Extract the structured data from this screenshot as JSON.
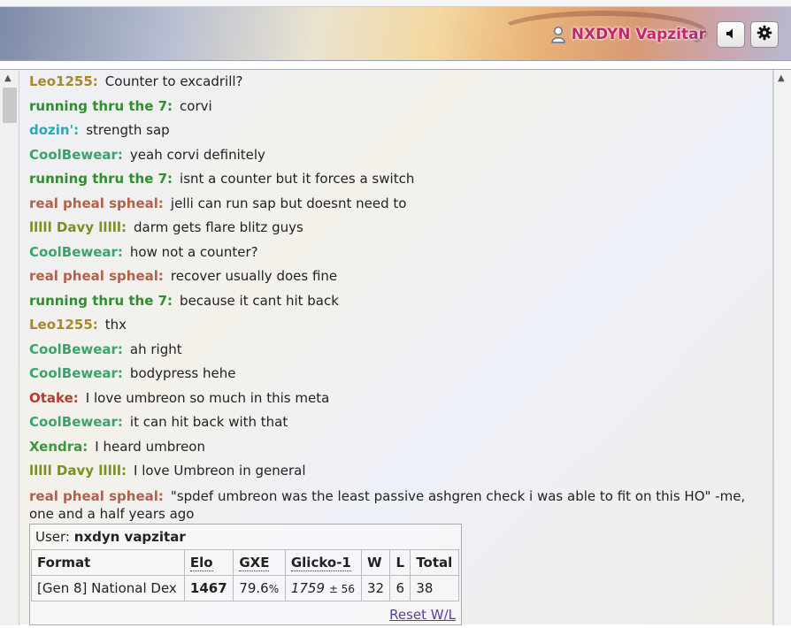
{
  "header": {
    "username": "NXDYN Vapzitar",
    "icons": {
      "user": "user-icon",
      "sound": "speaker-icon",
      "settings": "gear-icon"
    }
  },
  "colors": {
    "username_header": "#c0286a",
    "user_colors": {
      "Leo1255": "#a7882a",
      "running thru the 7": "#2f8f2f",
      "dozin'": "#2fa6b7",
      "CoolBewear": "#3aa36d",
      "real pheal spheal": "#b0624c",
      "Davy": "#7a8f1e",
      "Otake": "#b0402e",
      "Xendra": "#3a9a3a"
    }
  },
  "chat": {
    "messages": [
      {
        "user": "Leo1255:",
        "text": "Counter to excadrill?",
        "color": "#a7882a"
      },
      {
        "user": "running thru the 7:",
        "text": "corvi",
        "color": "#2f8f2f"
      },
      {
        "user": "dozin':",
        "text": "strength sap",
        "color": "#2fa6b7"
      },
      {
        "user": "CoolBewear:",
        "text": "yeah corvi definitely",
        "color": "#3aa36d"
      },
      {
        "user": "running thru the 7:",
        "text": "isnt a counter but it forces a switch",
        "color": "#2f8f2f"
      },
      {
        "user": "real pheal spheal:",
        "text": "jelli can run sap but doesnt need to",
        "color": "#b0624c"
      },
      {
        "user": "lllll Davy lllll:",
        "text": "darm gets flare blitz guys",
        "color": "#7a8f1e"
      },
      {
        "user": "CoolBewear:",
        "text": "how not a counter?",
        "color": "#3aa36d"
      },
      {
        "user": "real pheal spheal:",
        "text": "recover usually does fine",
        "color": "#b0624c"
      },
      {
        "user": "running thru the 7:",
        "text": "because it cant hit back",
        "color": "#2f8f2f"
      },
      {
        "user": "Leo1255:",
        "text": "thx",
        "color": "#a7882a"
      },
      {
        "user": "CoolBewear:",
        "text": "ah right",
        "color": "#3aa36d"
      },
      {
        "user": "CoolBewear:",
        "text": "bodypress hehe",
        "color": "#3aa36d"
      },
      {
        "user": "Otake:",
        "text": "I love umbreon so much in this meta",
        "color": "#b0402e"
      },
      {
        "user": "CoolBewear:",
        "text": "it can hit back with that",
        "color": "#3aa36d"
      },
      {
        "user": "Xendra:",
        "text": "I heard umbreon",
        "color": "#3a9a3a"
      },
      {
        "user": "lllll Davy lllll:",
        "text": "I love Umbreon in general",
        "color": "#7a8f1e"
      },
      {
        "user": "real pheal spheal:",
        "text": "\"spdef umbreon was the least passive ashgren check i was able to fit on this HO\" -me, one and a half years ago",
        "color": "#b0624c"
      }
    ]
  },
  "stats": {
    "user_label": "User:",
    "user_name": "nxdyn vapzitar",
    "headers": [
      "Format",
      "Elo",
      "GXE",
      "Glicko-1",
      "W",
      "L",
      "Total"
    ],
    "row": {
      "format": "[Gen 8] National Dex",
      "elo": "1467",
      "gxe": "79.6",
      "gxe_unit": "%",
      "glicko": "1759",
      "glicko_dev": "± 56",
      "w": "32",
      "l": "6",
      "total": "38"
    },
    "reset_label": "Reset W/L"
  }
}
